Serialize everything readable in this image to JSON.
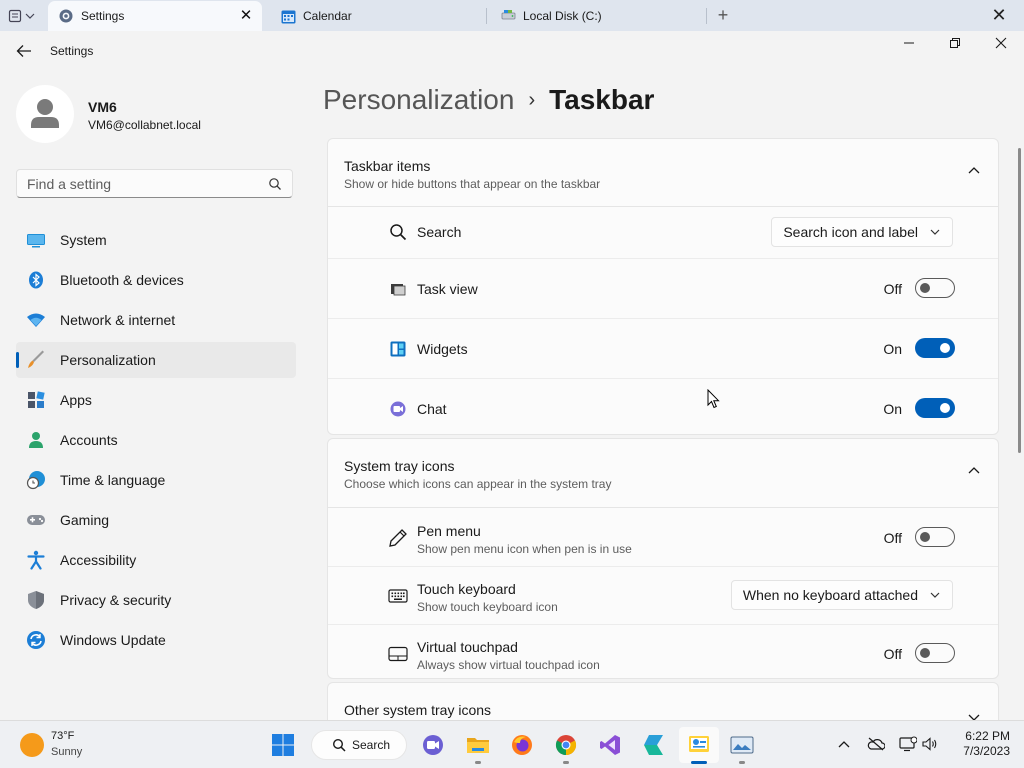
{
  "tabs": [
    {
      "label": "Settings",
      "icon": "gear-icon",
      "active": true
    },
    {
      "label": "Calendar",
      "icon": "calendar-icon"
    },
    {
      "label": "Local Disk (C:)",
      "icon": "drive-icon"
    }
  ],
  "window": {
    "app_title": "Settings"
  },
  "profile": {
    "name": "VM6",
    "email": "VM6@collabnet.local"
  },
  "search": {
    "placeholder": "Find a setting"
  },
  "nav": [
    {
      "label": "System",
      "icon": "system-display-icon"
    },
    {
      "label": "Bluetooth & devices",
      "icon": "bluetooth-icon"
    },
    {
      "label": "Network & internet",
      "icon": "wifi-icon"
    },
    {
      "label": "Personalization",
      "icon": "paintbrush-icon",
      "selected": true
    },
    {
      "label": "Apps",
      "icon": "apps-icon"
    },
    {
      "label": "Accounts",
      "icon": "accounts-icon"
    },
    {
      "label": "Time & language",
      "icon": "clock-globe-icon"
    },
    {
      "label": "Gaming",
      "icon": "gamepad-icon"
    },
    {
      "label": "Accessibility",
      "icon": "accessibility-icon"
    },
    {
      "label": "Privacy & security",
      "icon": "shield-icon"
    },
    {
      "label": "Windows Update",
      "icon": "update-icon"
    }
  ],
  "breadcrumb": {
    "parent": "Personalization",
    "separator": "›",
    "current": "Taskbar"
  },
  "taskbar_items": {
    "title": "Taskbar items",
    "subtitle": "Show or hide buttons that appear on the taskbar",
    "search": {
      "label": "Search",
      "dropdown": "Search icon and label"
    },
    "task_view": {
      "label": "Task view",
      "state": "Off"
    },
    "widgets": {
      "label": "Widgets",
      "state": "On"
    },
    "chat": {
      "label": "Chat",
      "state": "On"
    }
  },
  "system_tray": {
    "title": "System tray icons",
    "subtitle": "Choose which icons can appear in the system tray",
    "pen_menu": {
      "label": "Pen menu",
      "sub": "Show pen menu icon when pen is in use",
      "state": "Off"
    },
    "touch_keyboard": {
      "label": "Touch keyboard",
      "sub": "Show touch keyboard icon",
      "dropdown": "When no keyboard attached"
    },
    "virtual_touchpad": {
      "label": "Virtual touchpad",
      "sub": "Always show virtual touchpad icon",
      "state": "Off"
    }
  },
  "other_tray": {
    "title": "Other system tray icons"
  },
  "taskbar": {
    "weather_temp": "73°F",
    "weather_desc": "Sunny",
    "search_label": "Search",
    "time": "6:22 PM",
    "date": "7/3/2023"
  },
  "colors": {
    "accent": "#005fb8",
    "background": "#f3f3f3",
    "card": "#fbfbfb"
  }
}
